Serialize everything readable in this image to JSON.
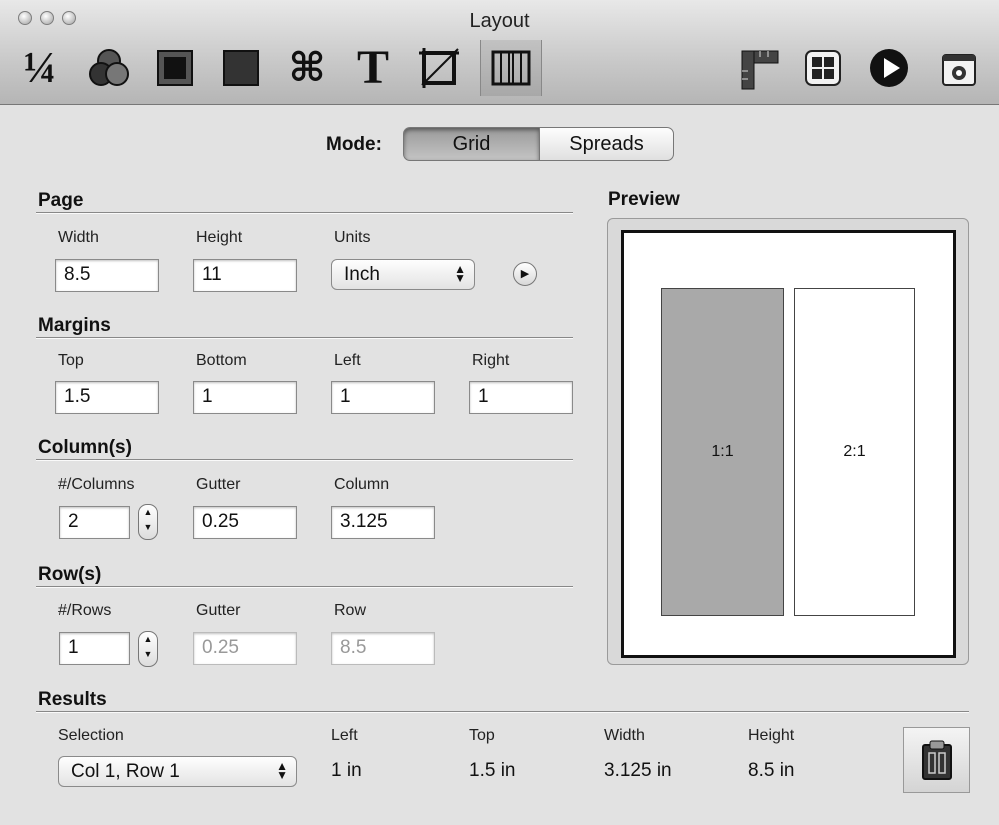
{
  "window": {
    "title": "Layout"
  },
  "toolbar": {
    "fraction_icon_text": "¼",
    "icons": [
      "fraction-icon",
      "color-circles-icon",
      "shadow-square-icon",
      "gray-square-icon",
      "command-icon",
      "text-icon",
      "crop-icon",
      "columns-icon",
      "ruler-icon",
      "grid-icon",
      "play-icon",
      "camera-icon"
    ]
  },
  "mode": {
    "label": "Mode:",
    "options": [
      "Grid",
      "Spreads"
    ],
    "selected": "Grid"
  },
  "page": {
    "heading": "Page",
    "width_label": "Width",
    "width_value": "8.5",
    "height_label": "Height",
    "height_value": "11",
    "units_label": "Units",
    "units_value": "Inch"
  },
  "margins": {
    "heading": "Margins",
    "top_label": "Top",
    "top_value": "1.5",
    "bottom_label": "Bottom",
    "bottom_value": "1",
    "left_label": "Left",
    "left_value": "1",
    "right_label": "Right",
    "right_value": "1"
  },
  "columns": {
    "heading": "Column(s)",
    "count_label": "#/Columns",
    "count_value": "2",
    "gutter_label": "Gutter",
    "gutter_value": "0.25",
    "column_label": "Column",
    "column_value": "3.125"
  },
  "rows": {
    "heading": "Row(s)",
    "count_label": "#/Rows",
    "count_value": "1",
    "gutter_label": "Gutter",
    "gutter_value": "0.25",
    "row_label": "Row",
    "row_value": "8.5"
  },
  "preview": {
    "heading": "Preview",
    "cells": [
      "1:1",
      "2:1"
    ],
    "selected_cell": "1:1"
  },
  "results": {
    "heading": "Results",
    "selection_label": "Selection",
    "selection_value": "Col 1, Row 1",
    "left_label": "Left",
    "left_value": "1 in",
    "top_label": "Top",
    "top_value": "1.5 in",
    "width_label": "Width",
    "width_value": "3.125 in",
    "height_label": "Height",
    "height_value": "8.5 in"
  },
  "colors": {
    "selected_cell": "#a9a9a9",
    "accent_dark": "#1a1a1a"
  }
}
